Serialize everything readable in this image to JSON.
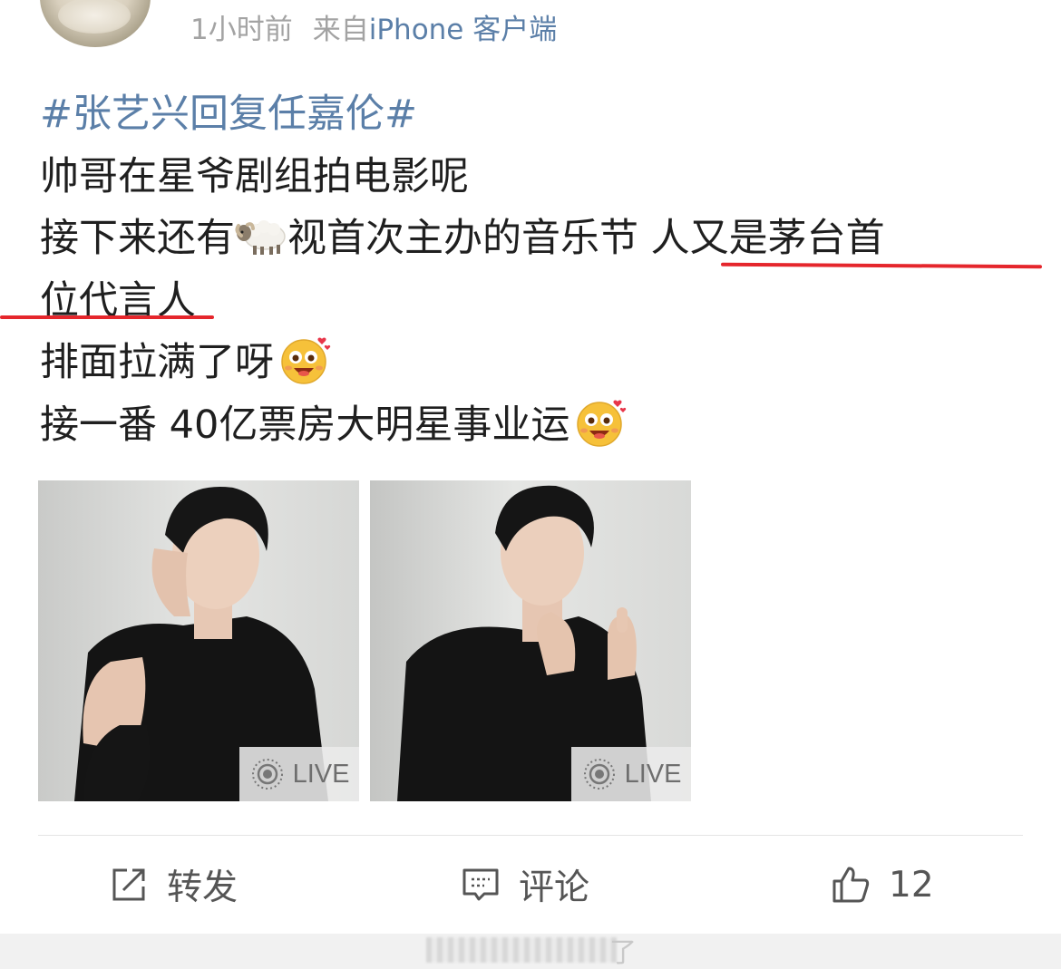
{
  "post": {
    "time": "1小时前",
    "source_prefix": "来自",
    "source_name": "iPhone 客户端",
    "hashtag": "#张艺兴回复任嘉伦#",
    "line2": "帅哥在星爷剧组拍电影呢",
    "line3_a": "接下来还有",
    "line3_b": "视首次主办的音乐节 人又是茅台首",
    "line4": "位代言人",
    "line5": "排面拉满了呀",
    "line6": "接一番 40亿票房大明星事业运",
    "emojis": [
      "sheep-emoji",
      "excited-face-emoji"
    ]
  },
  "photos": [
    {
      "badge": "LIVE"
    },
    {
      "badge": "LIVE"
    }
  ],
  "actions": {
    "repost_label": "转发",
    "comment_label": "评论",
    "like_count": "12"
  },
  "bottom_bar": {
    "partial_text": "了"
  },
  "colors": {
    "link": "#5b7fa8",
    "highlight_underline": "#e5262c",
    "meta_gray": "#a3a3a3"
  }
}
